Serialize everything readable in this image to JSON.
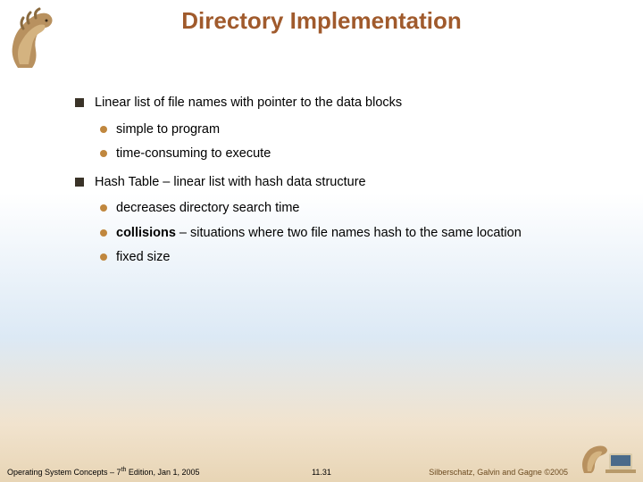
{
  "title": "Directory Implementation",
  "bullets": {
    "b1": "Linear list of file names with pointer to the data blocks",
    "b1a": "simple to program",
    "b1b": "time-consuming to execute",
    "b2": "Hash Table – linear list with hash data structure",
    "b2a": "decreases directory search time",
    "b2b_bold": "collisions",
    "b2b_rest": " – situations where two file names hash to the same location",
    "b2c": "fixed size"
  },
  "footer": {
    "left_pre": "Operating System Concepts – 7",
    "left_sup": "th",
    "left_post": " Edition, Jan 1, 2005",
    "center": "11.31",
    "right": "Silberschatz, Galvin and Gagne ©2005"
  }
}
